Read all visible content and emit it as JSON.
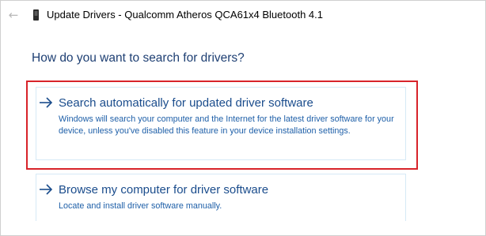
{
  "window": {
    "title": "Update Drivers - Qualcomm Atheros QCA61x4 Bluetooth 4.1"
  },
  "icons": {
    "back": "back-arrow-icon",
    "device": "bluetooth-device-icon",
    "option_arrow": "right-arrow-icon"
  },
  "main": {
    "heading": "How do you want to search for drivers?",
    "options": [
      {
        "title": "Search automatically for updated driver software",
        "description": "Windows will search your computer and the Internet for the latest driver software for your device, unless you've disabled this feature in your device installation settings."
      },
      {
        "title": "Browse my computer for driver software",
        "description": "Locate and install driver software manually."
      }
    ]
  },
  "colors": {
    "heading": "#1e3f73",
    "option_title": "#1a4c8c",
    "highlight": "#d8232a"
  }
}
